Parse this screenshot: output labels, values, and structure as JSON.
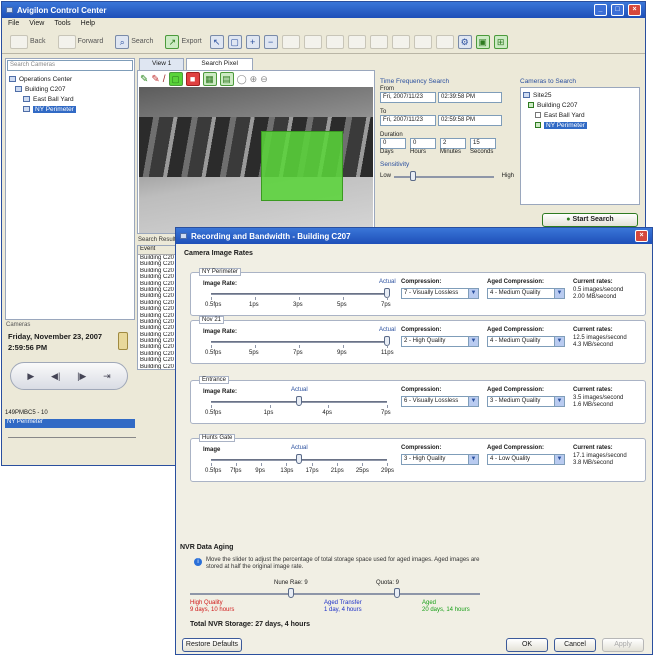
{
  "main_window": {
    "title": "Avigilon Control Center",
    "menu": [
      "File",
      "View",
      "Tools",
      "Help"
    ],
    "toolbar": {
      "back_label": "Back",
      "forward_label": "Forward",
      "search_label": "Search",
      "export_label": "Export"
    },
    "search_field_placeholder": "Search Cameras",
    "tree": {
      "root": "Operations Center",
      "server": "Building C207",
      "cameras": [
        "East Ball Yard",
        "NY Perimeter"
      ]
    },
    "view_tabs": [
      "View 1",
      "Search Pixel"
    ],
    "time_search": {
      "title": "Time Frequency Search",
      "from_label": "From",
      "from_date": "Fri, 2007/11/23",
      "from_time": "02:39:58 PM",
      "to_label": "To",
      "to_date": "Fri, 2007/11/23",
      "to_time": "02:59:58 PM",
      "duration_label": "Duration",
      "duration_values": [
        "0",
        "0",
        "2",
        "15"
      ],
      "duration_units": [
        "Days",
        "Hours",
        "Minutes",
        "Seconds"
      ],
      "sensitivity_label": "Sensitivity",
      "low_label": "Low",
      "high_label": "High"
    },
    "cameras_to_search": {
      "title": "Cameras to Search",
      "root": "Site25",
      "server": "Building C207",
      "cameras": [
        "East Ball Yard",
        "NY Perimeter"
      ]
    },
    "start_search_label": "Start Search",
    "results_header": "Search Results",
    "results_column": "Event",
    "results_rows": [
      "Building C20",
      "Building C20",
      "Building C20",
      "Building C20",
      "Building C20",
      "Building C20",
      "Building C20",
      "Building C20",
      "Building C20",
      "Building C20",
      "Building C20",
      "Building C20",
      "Building C20",
      "Building C20",
      "Building C20",
      "Building C20",
      "Building C20",
      "Building C20"
    ],
    "sidebar_header": "Cameras",
    "date_label": "Friday, November 23, 2007",
    "time_label": "2:59:56 PM",
    "camera_list": [
      "149PMBC5 - 10",
      "NY Perimeter"
    ]
  },
  "dialog": {
    "title": "Recording and Bandwidth - Building C207",
    "section_title": "Camera Image Rates",
    "cameras": [
      {
        "name": "NY Perimeter",
        "rate_label": "Image Rate:",
        "actual_label": "Actual",
        "ticks": [
          "0.5fps",
          "1ps",
          "3ps",
          "5ps",
          "7ps"
        ],
        "thumb_fraction": 1.0,
        "compression_label": "Compression:",
        "compression_value": "7 - Visually Lossless",
        "aged_compression_label": "Aged Compression:",
        "aged_compression_value": "4 - Medium Quality",
        "current_rates_label": "Current rates:",
        "current_rates_line1": "0.5 images/second",
        "current_rates_line2": "2.00 MB/second"
      },
      {
        "name": "Nov 21",
        "rate_label": "Image Rate:",
        "actual_label": "Actual",
        "ticks": [
          "0.5fps",
          "5ps",
          "7ps",
          "9ps",
          "11ps"
        ],
        "thumb_fraction": 1.0,
        "compression_label": "Compression:",
        "compression_value": "2 - High Quality",
        "aged_compression_label": "Aged Compression:",
        "aged_compression_value": "4 - Medium Quality",
        "current_rates_label": "Current rates:",
        "current_rates_line1": "12.5 images/second",
        "current_rates_line2": "4.3 MB/second"
      },
      {
        "name": "Entrance",
        "rate_label": "Image Rate:",
        "actual_label": "Actual",
        "ticks": [
          "0.5fps",
          "1ps",
          "4ps",
          "7ps"
        ],
        "thumb_fraction": 0.5,
        "compression_label": "Compression:",
        "compression_value": "6 - Visually Lossless",
        "aged_compression_label": "Aged Compression:",
        "aged_compression_value": "3 - Medium Quality",
        "current_rates_label": "Current rates:",
        "current_rates_line1": "3.5 images/second",
        "current_rates_line2": "1.6 MB/second"
      },
      {
        "name": "Hunts Gate",
        "rate_label": "Image",
        "actual_label": "Actual",
        "ticks": [
          "0.5fps",
          "7fps",
          "9ps",
          "13ps",
          "17ps",
          "21ps",
          "25ps",
          "29ps"
        ],
        "thumb_fraction": 0.5,
        "compression_label": "Compression:",
        "compression_value": "3 - High Quality",
        "aged_compression_label": "Aged Compression:",
        "aged_compression_value": "4 - Low Quality",
        "current_rates_label": "Current rates:",
        "current_rates_line1": "17.1 images/second",
        "current_rates_line2": "3.8 MB/second"
      }
    ],
    "aging": {
      "title": "NVR Data Aging",
      "description": "Move the slider to adjust the percentage of total storage space used for aged images. Aged images are stored at half the original image rate.",
      "marker1": "Nune Rae: 9",
      "marker2": "Quota: 9",
      "high_quality_label": "High Quality",
      "high_quality_value": "9 days, 10 hours",
      "aged_transfer_label": "Aged Transfer",
      "aged_transfer_value": "1 day, 4 hours",
      "aged_label": "Aged",
      "aged_value": "20 days, 14 hours",
      "total_label": "Total NVR Storage: 27 days, 4 hours"
    },
    "buttons": {
      "restore": "Restore Defaults",
      "ok": "OK",
      "cancel": "Cancel",
      "apply": "Apply"
    }
  },
  "colors": {
    "titlebar": "#2a5fc6",
    "highlight_green": "#5ad43a",
    "high_quality": "#d01818",
    "aged_transfer": "#1c2fc8",
    "aged": "#18a018"
  }
}
